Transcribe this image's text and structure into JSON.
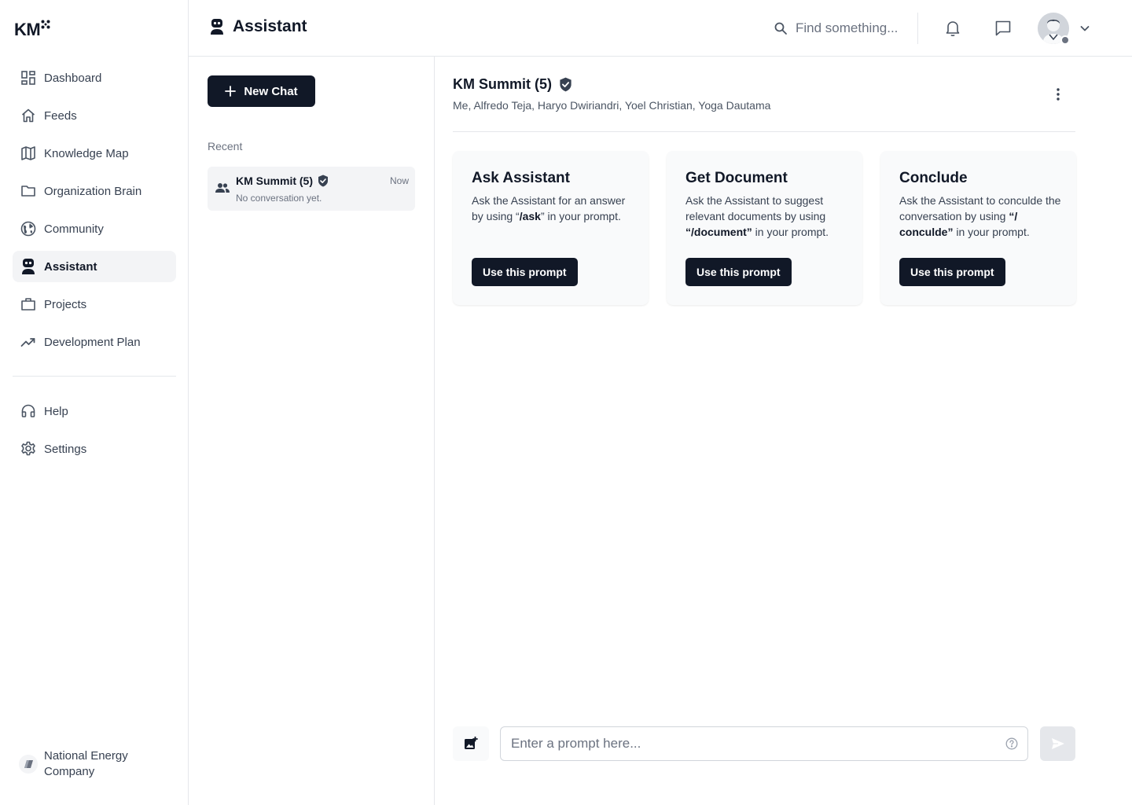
{
  "brand": {
    "logo_text": "KM"
  },
  "sidebar": {
    "items": [
      {
        "label": "Dashboard",
        "icon": "dashboard-icon"
      },
      {
        "label": "Feeds",
        "icon": "home-icon"
      },
      {
        "label": "Knowledge Map",
        "icon": "map-icon"
      },
      {
        "label": "Organization Brain",
        "icon": "folder-icon"
      },
      {
        "label": "Community",
        "icon": "globe-icon"
      },
      {
        "label": "Assistant",
        "icon": "robot-icon",
        "active": true
      },
      {
        "label": "Projects",
        "icon": "briefcase-icon"
      },
      {
        "label": "Development Plan",
        "icon": "trending-up-icon"
      }
    ],
    "secondary": [
      {
        "label": "Help",
        "icon": "headset-icon"
      },
      {
        "label": "Settings",
        "icon": "gear-icon"
      }
    ],
    "organization": {
      "name": "National Energy Company"
    }
  },
  "header": {
    "title": "Assistant",
    "search": {
      "placeholder": "Find something..."
    }
  },
  "chatlist": {
    "new_chat_label": "New Chat",
    "recent_label": "Recent",
    "items": [
      {
        "name": "KM Summit (5)",
        "time": "Now",
        "preview": "No conversation yet."
      }
    ]
  },
  "conversation": {
    "title": "KM Summit (5)",
    "members": "Me, Alfredo Teja, Haryo Dwiriandri, Yoel Christian, Yoga Dautama",
    "cards": [
      {
        "title": "Ask Assistant",
        "desc_pre": "Ask the Assistant for an answer by using “",
        "command": "/ask",
        "desc_post": "” in your prompt.",
        "button": "Use this prompt"
      },
      {
        "title": "Get Document",
        "desc_pre": "Ask the Assistant to suggest relevant documents by using ",
        "command": "“/document”",
        "desc_post": " in your prompt.",
        "button": "Use this prompt"
      },
      {
        "title": "Conclude",
        "desc_pre": "Ask the Assistant to conculde the conversation by using ",
        "command": "“/ conculde”",
        "desc_post": " in your prompt.",
        "button": "Use this prompt"
      }
    ],
    "prompt": {
      "placeholder": "Enter a prompt here..."
    }
  },
  "colors": {
    "primary": "#111827",
    "active_bg": "#f3f4f6",
    "border": "#e5e7eb",
    "muted_text": "#6b7280",
    "status_dot": "#6b7280"
  }
}
